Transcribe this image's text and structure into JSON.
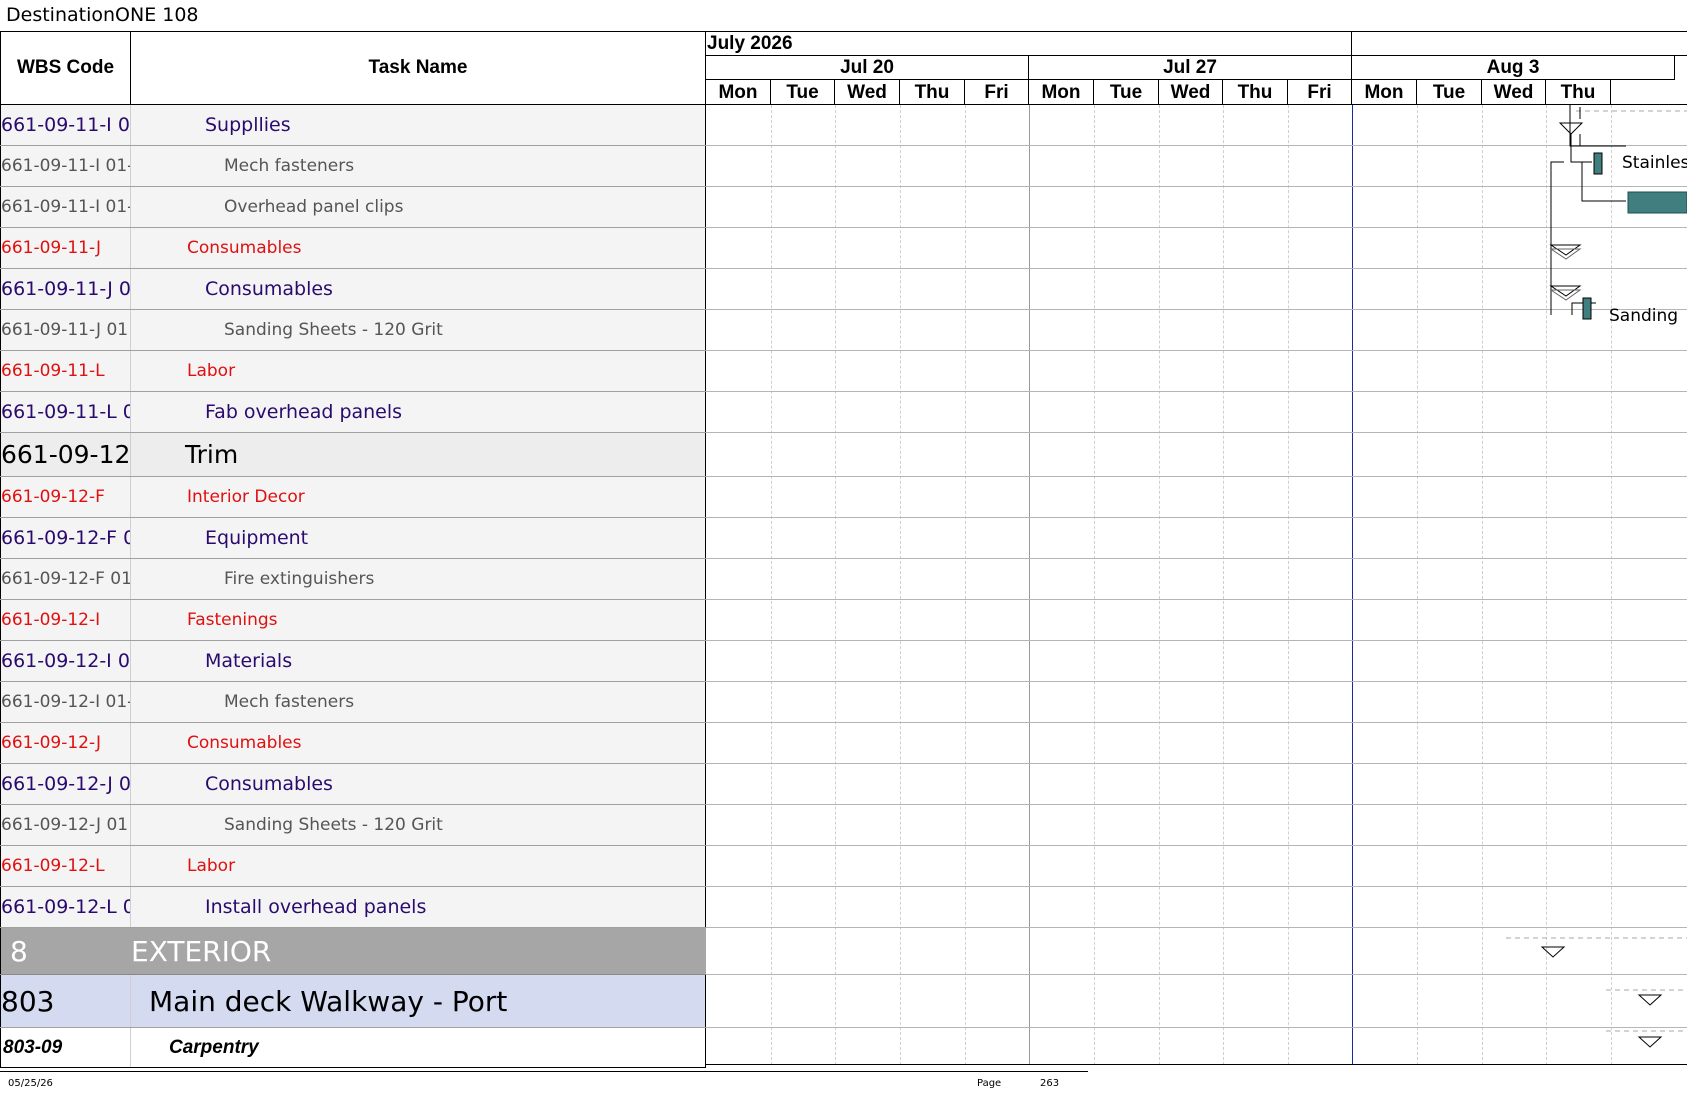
{
  "window": {
    "title": "DestinationONE 108"
  },
  "columns": {
    "wbs_code": "WBS Code",
    "task_name": "Task Name"
  },
  "timescale": {
    "months": [
      {
        "label": "July 2026"
      },
      {
        "label": ""
      }
    ],
    "weeks": [
      {
        "label": "Jul 20"
      },
      {
        "label": "Jul 27"
      },
      {
        "label": "Aug 3"
      }
    ],
    "days": [
      "Mon",
      "Tue",
      "Wed",
      "Thu",
      "Fri",
      "Mon",
      "Tue",
      "Wed",
      "Thu",
      "Fri",
      "Mon",
      "Tue",
      "Wed",
      "Thu"
    ]
  },
  "rows": [
    {
      "wbs": "661-09-11-I 0",
      "task": "Suppllies",
      "level": "purple"
    },
    {
      "wbs": "661-09-11-I 01-",
      "task": "Mech fasteners",
      "level": "gray"
    },
    {
      "wbs": "661-09-11-I 01-",
      "task": "Overhead panel clips",
      "level": "gray"
    },
    {
      "wbs": "661-09-11-J",
      "task": "Consumables",
      "level": "red"
    },
    {
      "wbs": "661-09-11-J 0",
      "task": "Consumables",
      "level": "purple"
    },
    {
      "wbs": "661-09-11-J 01",
      "task": "Sanding Sheets - 120 Grit",
      "level": "gray"
    },
    {
      "wbs": "661-09-11-L",
      "task": "Labor",
      "level": "red"
    },
    {
      "wbs": "661-09-11-L 0",
      "task": "Fab overhead panels",
      "level": "purple"
    },
    {
      "wbs": "661-09-12",
      "task": "Trim",
      "level": "trim"
    },
    {
      "wbs": "661-09-12-F",
      "task": "Interior Decor",
      "level": "red"
    },
    {
      "wbs": "661-09-12-F 0",
      "task": "Equipment",
      "level": "purple"
    },
    {
      "wbs": "661-09-12-F 01",
      "task": "Fire extinguishers",
      "level": "gray"
    },
    {
      "wbs": "661-09-12-I",
      "task": "Fastenings",
      "level": "red"
    },
    {
      "wbs": "661-09-12-I 0",
      "task": "Materials",
      "level": "purple"
    },
    {
      "wbs": "661-09-12-I 01-",
      "task": "Mech fasteners",
      "level": "gray"
    },
    {
      "wbs": "661-09-12-J",
      "task": "Consumables",
      "level": "red"
    },
    {
      "wbs": "661-09-12-J 0",
      "task": "Consumables",
      "level": "purple"
    },
    {
      "wbs": "661-09-12-J 01",
      "task": "Sanding Sheets - 120 Grit",
      "level": "gray"
    },
    {
      "wbs": "661-09-12-L",
      "task": "Labor",
      "level": "red"
    },
    {
      "wbs": "661-09-12-L 0",
      "task": "Install overhead panels",
      "level": "purple"
    },
    {
      "wbs": "8",
      "task": "EXTERIOR",
      "level": "exterior"
    },
    {
      "wbs": "803",
      "task": "Main deck Walkway - Port",
      "level": "main"
    },
    {
      "wbs": "803-09",
      "task": "Carpentry",
      "level": "carp"
    }
  ],
  "bar_labels": {
    "stainless": "Stainles",
    "sanding": "Sanding"
  },
  "colors": {
    "bar": "#3f7f7f",
    "today_line": "#1a28a8",
    "red_text": "#e01010",
    "purple_text": "#2a0a6e",
    "exterior_bg": "#a6a6a6",
    "main_bg": "#d4daf0"
  },
  "footer": {
    "date": "05/25/26",
    "page_label": "Page",
    "page_number": "263"
  }
}
